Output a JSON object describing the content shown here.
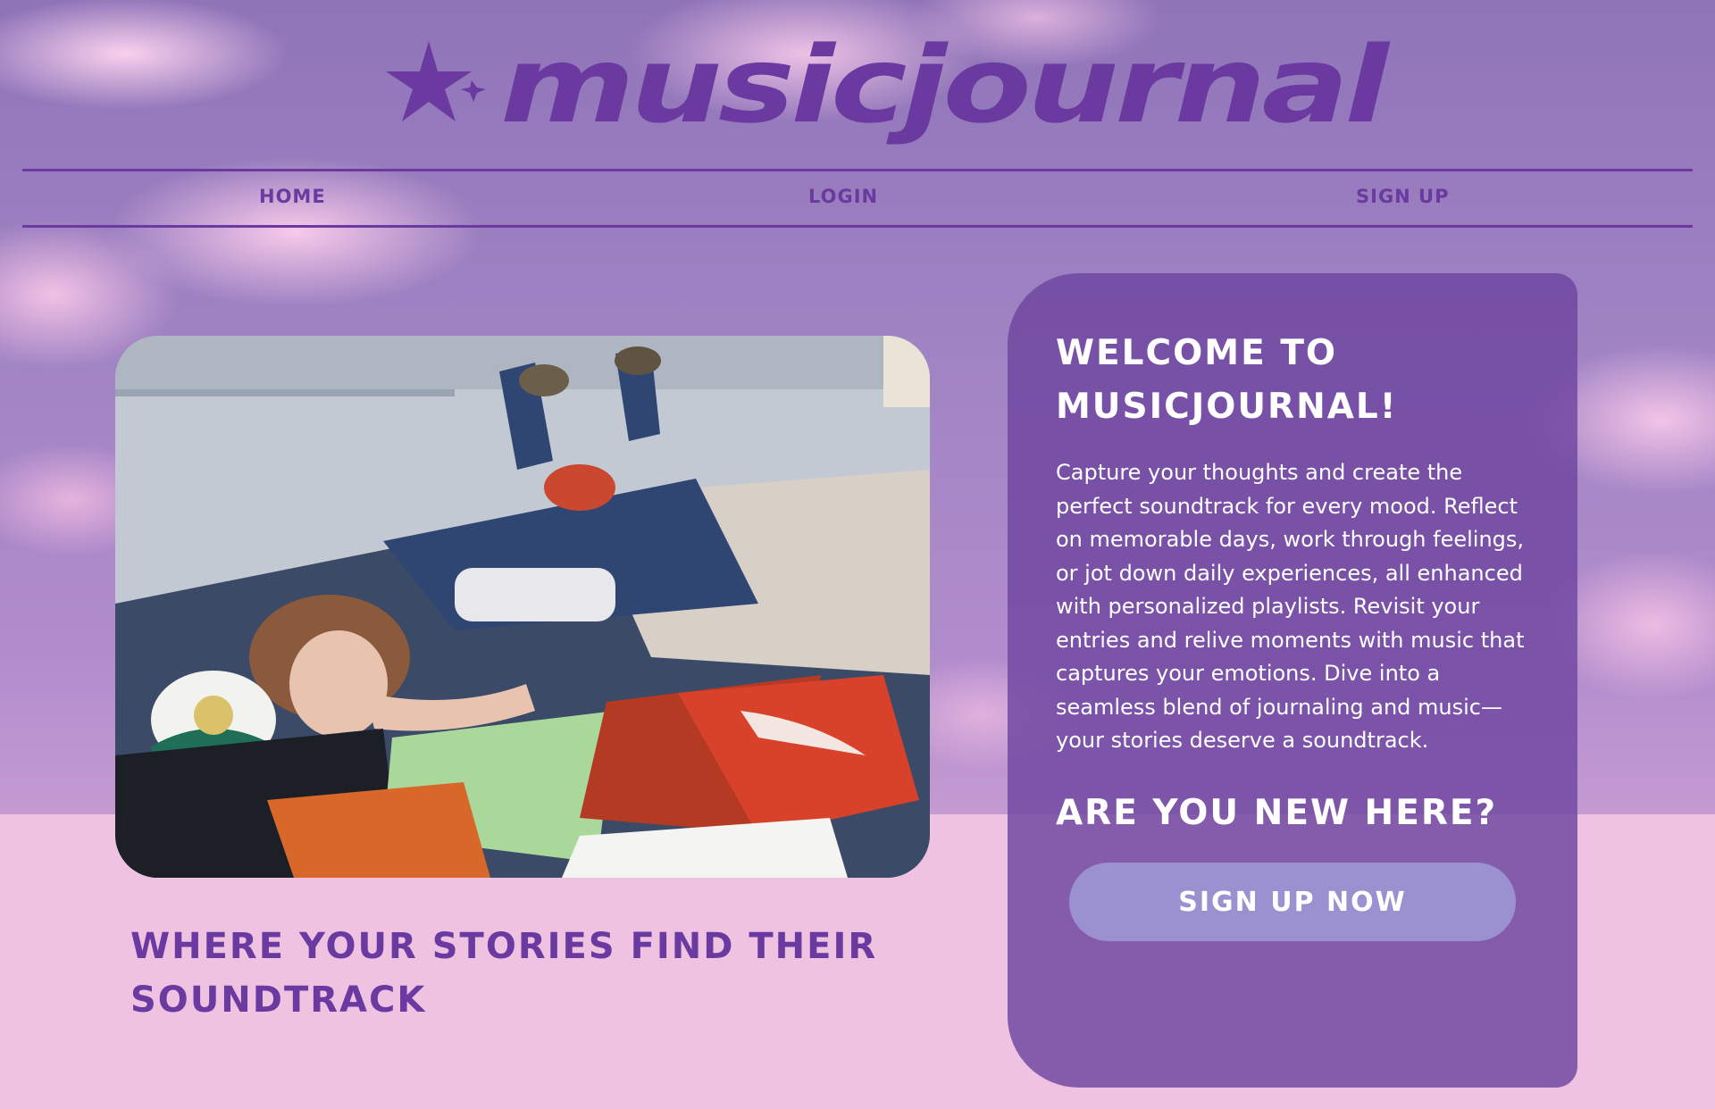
{
  "brand": {
    "logo_text": "musicjournal",
    "accent_color": "#6a3aa0",
    "icon": "star-moon-icon"
  },
  "nav": [
    {
      "label": "HOME"
    },
    {
      "label": "LOGIN"
    },
    {
      "label": "SIGN UP"
    }
  ],
  "hero": {
    "image_icon": "vinyl-photo",
    "tagline": "WHERE YOUR STORIES FIND THEIR SOUNDTRACK"
  },
  "welcome": {
    "title": "WELCOME TO MUSICJOURNAL!",
    "body": "Capture your thoughts and create the perfect soundtrack for every mood. Reflect on memorable days, work through feelings, or jot down daily experiences, all enhanced with personalized playlists. Revisit your entries and relive moments with music that captures your emotions. Dive into a seamless blend of journaling and music—your stories deserve a soundtrack.",
    "question": "ARE YOU NEW HERE?",
    "cta_label": "SIGN UP NOW",
    "card_color": "#6e46a0",
    "button_color": "#9b90d0"
  }
}
